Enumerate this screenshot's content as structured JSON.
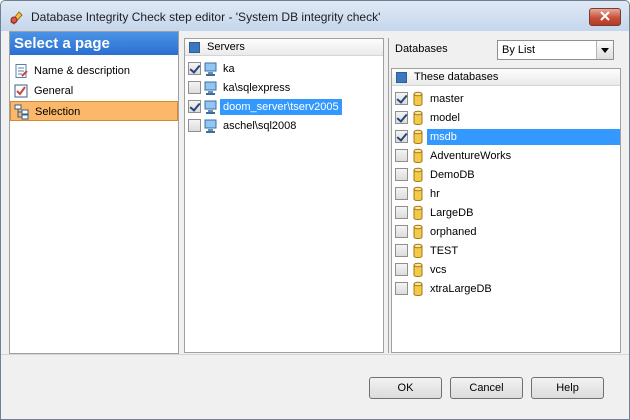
{
  "window": {
    "title": "Database Integrity Check step editor - 'System DB integrity check'"
  },
  "sidebar": {
    "header": "Select a page",
    "items": [
      {
        "label": "Name & description",
        "icon": "document-icon",
        "selected": false
      },
      {
        "label": "General",
        "icon": "checklist-icon",
        "selected": false
      },
      {
        "label": "Selection",
        "icon": "tree-icon",
        "selected": true
      }
    ]
  },
  "servers": {
    "header": "Servers",
    "items": [
      {
        "name": "ka",
        "checked": true,
        "selected": false
      },
      {
        "name": "ka\\sqlexpress",
        "checked": false,
        "selected": false
      },
      {
        "name": "doom_server\\tserv2005",
        "checked": true,
        "selected": true
      },
      {
        "name": "aschel\\sql2008",
        "checked": false,
        "selected": false
      }
    ]
  },
  "databases": {
    "label": "Databases",
    "mode": "By List",
    "header": "These databases",
    "items": [
      {
        "name": "master",
        "checked": true,
        "selected": false
      },
      {
        "name": "model",
        "checked": true,
        "selected": false
      },
      {
        "name": "msdb",
        "checked": true,
        "selected": true
      },
      {
        "name": "AdventureWorks",
        "checked": false,
        "selected": false
      },
      {
        "name": "DemoDB",
        "checked": false,
        "selected": false
      },
      {
        "name": "hr",
        "checked": false,
        "selected": false
      },
      {
        "name": "LargeDB",
        "checked": false,
        "selected": false
      },
      {
        "name": "orphaned",
        "checked": false,
        "selected": false
      },
      {
        "name": "TEST",
        "checked": false,
        "selected": false
      },
      {
        "name": "vcs",
        "checked": false,
        "selected": false
      },
      {
        "name": "xtraLargeDB",
        "checked": false,
        "selected": false
      }
    ]
  },
  "buttons": {
    "ok": "OK",
    "cancel": "Cancel",
    "help": "Help"
  },
  "colors": {
    "selection": "#3399ff",
    "sidebar_selected": "#fbb86a",
    "header_blue": "#2a6fd1"
  }
}
